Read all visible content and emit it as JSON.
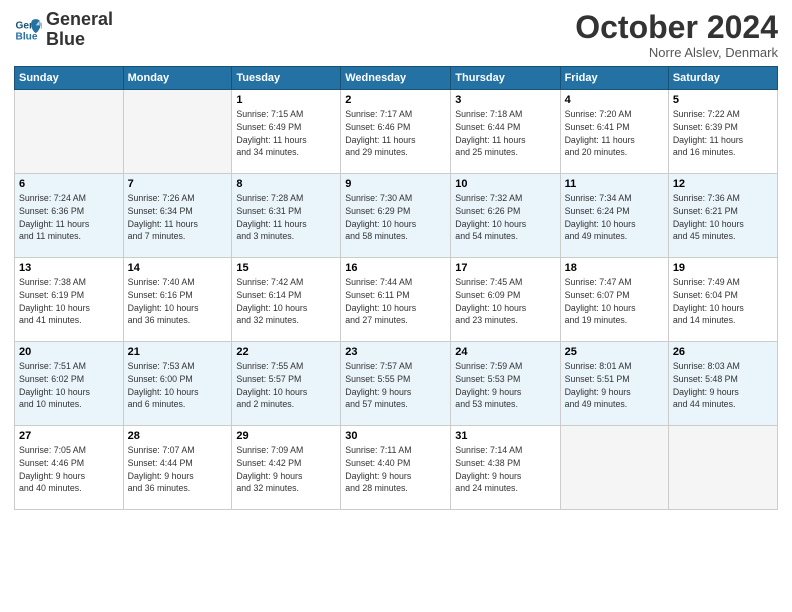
{
  "header": {
    "logo_line1": "General",
    "logo_line2": "Blue",
    "month": "October 2024",
    "location": "Norre Alslev, Denmark"
  },
  "weekdays": [
    "Sunday",
    "Monday",
    "Tuesday",
    "Wednesday",
    "Thursday",
    "Friday",
    "Saturday"
  ],
  "weeks": [
    [
      {
        "day": "",
        "detail": ""
      },
      {
        "day": "",
        "detail": ""
      },
      {
        "day": "1",
        "detail": "Sunrise: 7:15 AM\nSunset: 6:49 PM\nDaylight: 11 hours\nand 34 minutes."
      },
      {
        "day": "2",
        "detail": "Sunrise: 7:17 AM\nSunset: 6:46 PM\nDaylight: 11 hours\nand 29 minutes."
      },
      {
        "day": "3",
        "detail": "Sunrise: 7:18 AM\nSunset: 6:44 PM\nDaylight: 11 hours\nand 25 minutes."
      },
      {
        "day": "4",
        "detail": "Sunrise: 7:20 AM\nSunset: 6:41 PM\nDaylight: 11 hours\nand 20 minutes."
      },
      {
        "day": "5",
        "detail": "Sunrise: 7:22 AM\nSunset: 6:39 PM\nDaylight: 11 hours\nand 16 minutes."
      }
    ],
    [
      {
        "day": "6",
        "detail": "Sunrise: 7:24 AM\nSunset: 6:36 PM\nDaylight: 11 hours\nand 11 minutes."
      },
      {
        "day": "7",
        "detail": "Sunrise: 7:26 AM\nSunset: 6:34 PM\nDaylight: 11 hours\nand 7 minutes."
      },
      {
        "day": "8",
        "detail": "Sunrise: 7:28 AM\nSunset: 6:31 PM\nDaylight: 11 hours\nand 3 minutes."
      },
      {
        "day": "9",
        "detail": "Sunrise: 7:30 AM\nSunset: 6:29 PM\nDaylight: 10 hours\nand 58 minutes."
      },
      {
        "day": "10",
        "detail": "Sunrise: 7:32 AM\nSunset: 6:26 PM\nDaylight: 10 hours\nand 54 minutes."
      },
      {
        "day": "11",
        "detail": "Sunrise: 7:34 AM\nSunset: 6:24 PM\nDaylight: 10 hours\nand 49 minutes."
      },
      {
        "day": "12",
        "detail": "Sunrise: 7:36 AM\nSunset: 6:21 PM\nDaylight: 10 hours\nand 45 minutes."
      }
    ],
    [
      {
        "day": "13",
        "detail": "Sunrise: 7:38 AM\nSunset: 6:19 PM\nDaylight: 10 hours\nand 41 minutes."
      },
      {
        "day": "14",
        "detail": "Sunrise: 7:40 AM\nSunset: 6:16 PM\nDaylight: 10 hours\nand 36 minutes."
      },
      {
        "day": "15",
        "detail": "Sunrise: 7:42 AM\nSunset: 6:14 PM\nDaylight: 10 hours\nand 32 minutes."
      },
      {
        "day": "16",
        "detail": "Sunrise: 7:44 AM\nSunset: 6:11 PM\nDaylight: 10 hours\nand 27 minutes."
      },
      {
        "day": "17",
        "detail": "Sunrise: 7:45 AM\nSunset: 6:09 PM\nDaylight: 10 hours\nand 23 minutes."
      },
      {
        "day": "18",
        "detail": "Sunrise: 7:47 AM\nSunset: 6:07 PM\nDaylight: 10 hours\nand 19 minutes."
      },
      {
        "day": "19",
        "detail": "Sunrise: 7:49 AM\nSunset: 6:04 PM\nDaylight: 10 hours\nand 14 minutes."
      }
    ],
    [
      {
        "day": "20",
        "detail": "Sunrise: 7:51 AM\nSunset: 6:02 PM\nDaylight: 10 hours\nand 10 minutes."
      },
      {
        "day": "21",
        "detail": "Sunrise: 7:53 AM\nSunset: 6:00 PM\nDaylight: 10 hours\nand 6 minutes."
      },
      {
        "day": "22",
        "detail": "Sunrise: 7:55 AM\nSunset: 5:57 PM\nDaylight: 10 hours\nand 2 minutes."
      },
      {
        "day": "23",
        "detail": "Sunrise: 7:57 AM\nSunset: 5:55 PM\nDaylight: 9 hours\nand 57 minutes."
      },
      {
        "day": "24",
        "detail": "Sunrise: 7:59 AM\nSunset: 5:53 PM\nDaylight: 9 hours\nand 53 minutes."
      },
      {
        "day": "25",
        "detail": "Sunrise: 8:01 AM\nSunset: 5:51 PM\nDaylight: 9 hours\nand 49 minutes."
      },
      {
        "day": "26",
        "detail": "Sunrise: 8:03 AM\nSunset: 5:48 PM\nDaylight: 9 hours\nand 44 minutes."
      }
    ],
    [
      {
        "day": "27",
        "detail": "Sunrise: 7:05 AM\nSunset: 4:46 PM\nDaylight: 9 hours\nand 40 minutes."
      },
      {
        "day": "28",
        "detail": "Sunrise: 7:07 AM\nSunset: 4:44 PM\nDaylight: 9 hours\nand 36 minutes."
      },
      {
        "day": "29",
        "detail": "Sunrise: 7:09 AM\nSunset: 4:42 PM\nDaylight: 9 hours\nand 32 minutes."
      },
      {
        "day": "30",
        "detail": "Sunrise: 7:11 AM\nSunset: 4:40 PM\nDaylight: 9 hours\nand 28 minutes."
      },
      {
        "day": "31",
        "detail": "Sunrise: 7:14 AM\nSunset: 4:38 PM\nDaylight: 9 hours\nand 24 minutes."
      },
      {
        "day": "",
        "detail": ""
      },
      {
        "day": "",
        "detail": ""
      }
    ]
  ]
}
